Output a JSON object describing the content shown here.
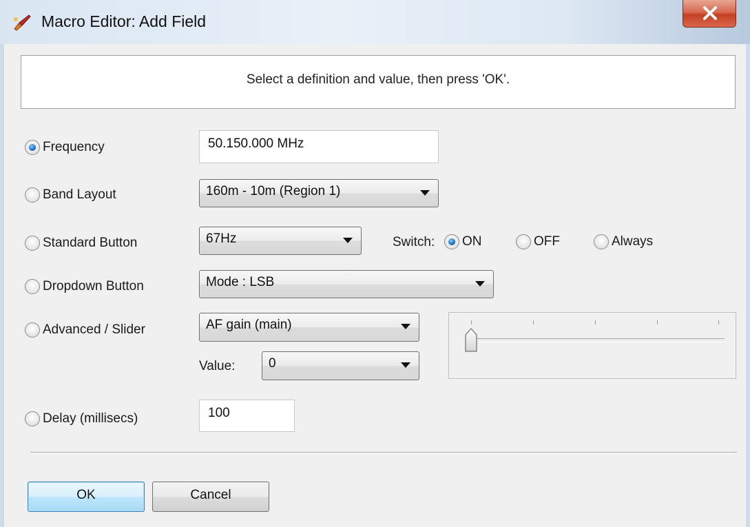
{
  "window": {
    "title": "Macro Editor: Add Field",
    "icon": "app-brush-icon",
    "close_glyph": "X"
  },
  "instruction": "Select a definition and value, then press 'OK'.",
  "fields": {
    "frequency": {
      "label": "Frequency",
      "checked": true,
      "value": "50.150.000 MHz"
    },
    "band_layout": {
      "label": "Band Layout",
      "checked": false,
      "value": "160m - 10m (Region 1)"
    },
    "standard_button": {
      "label": "Standard Button",
      "checked": false,
      "value": "67Hz",
      "switch_label": "Switch:",
      "switch_options": [
        {
          "label": "ON",
          "checked": true
        },
        {
          "label": "OFF",
          "checked": false
        },
        {
          "label": "Always",
          "checked": false
        }
      ]
    },
    "dropdown_button": {
      "label": "Dropdown Button",
      "checked": false,
      "value": "Mode : LSB"
    },
    "advanced_slider": {
      "label": "Advanced / Slider",
      "checked": false,
      "value": "AF gain (main)",
      "value_label": "Value:",
      "value_selected": "0",
      "slider_level": 0
    },
    "delay": {
      "label": "Delay (millisecs)",
      "checked": false,
      "value": "100"
    }
  },
  "buttons": {
    "ok": "OK",
    "cancel": "Cancel"
  },
  "colors": {
    "accent": "#1e73c8",
    "close_red": "#c43f23",
    "ok_border": "#3c7fb1"
  }
}
